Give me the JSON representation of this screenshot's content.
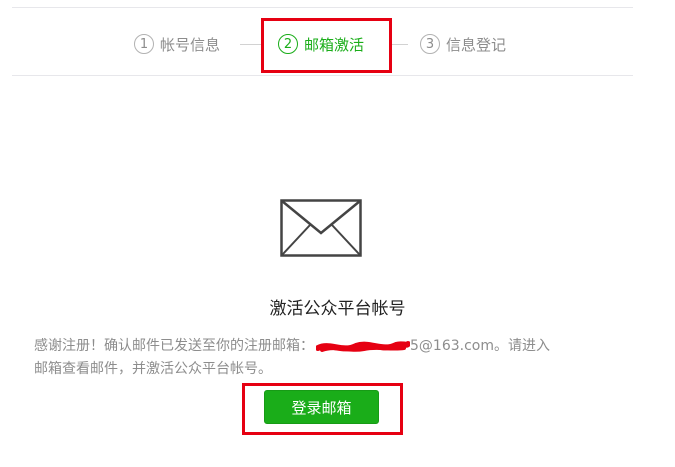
{
  "steps": [
    {
      "number": "1",
      "label": "帐号信息",
      "active": false
    },
    {
      "number": "2",
      "label": "邮箱激活",
      "active": true
    },
    {
      "number": "3",
      "label": "信息登记",
      "active": false
    }
  ],
  "main": {
    "title": "激活公众平台帐号",
    "description_before": "感谢注册！确认邮件已发送至你的注册邮箱：",
    "email_suffix": "5@163.com。请进入",
    "description_after": "邮箱查看邮件，并激活公众平台帐号。",
    "button_label": "登录邮箱",
    "icon": "envelope-icon"
  },
  "colors": {
    "accent": "#1aad19",
    "highlight": "#e60012",
    "text_muted": "#8d8d8d"
  }
}
